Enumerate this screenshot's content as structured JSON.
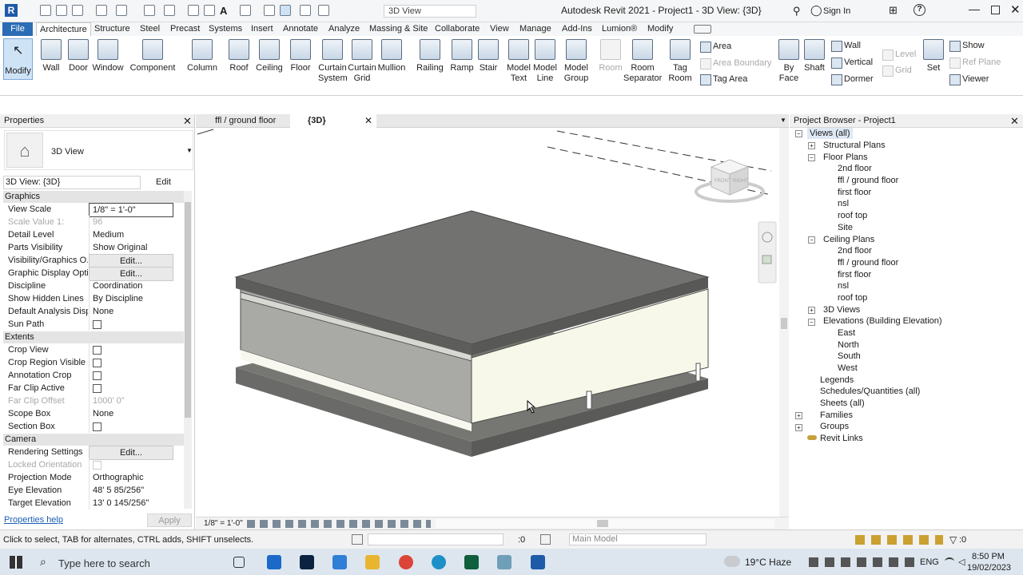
{
  "qat": {
    "view_dropdown": "3D View",
    "title": "Autodesk Revit 2021 - Project1 - 3D View: {3D}",
    "sign_in": "Sign In"
  },
  "tabs": [
    "File",
    "Architecture",
    "Structure",
    "Steel",
    "Precast",
    "Systems",
    "Insert",
    "Annotate",
    "Analyze",
    "Massing & Site",
    "Collaborate",
    "View",
    "Manage",
    "Add-Ins",
    "Lumion®",
    "Modify"
  ],
  "ribbon": {
    "modify": "Modify",
    "build": [
      [
        "Wall",
        "Door",
        "Window",
        "Component",
        "Column",
        "Roof",
        "Ceiling",
        "Floor",
        "Curtain",
        "Curtain",
        "Mullion"
      ],
      [
        "",
        "",
        "",
        "",
        "",
        "",
        "",
        "",
        "System",
        "Grid",
        ""
      ]
    ],
    "circ": [
      [
        "Railing",
        "Ramp",
        "Stair"
      ]
    ],
    "model": [
      [
        "Model",
        "Model",
        "Model"
      ],
      [
        "Text",
        "Line",
        "Group"
      ]
    ],
    "room": [
      "Room",
      "Room",
      "Tag",
      "Separator",
      "Room"
    ],
    "area": [
      "Area",
      "Area  Boundary",
      "Tag  Area"
    ],
    "opening": [
      "By",
      "Face",
      "Shaft",
      "Wall",
      "Vertical",
      "Dormer"
    ],
    "datum": [
      "Level",
      "Grid"
    ],
    "set": "Set",
    "show": [
      "Show",
      "Ref  Plane",
      "Viewer"
    ]
  },
  "props": {
    "title": "Properties",
    "type_name": "3D View",
    "selector": "3D View: {3D}",
    "edit_type": "Edit Type",
    "sections": [
      "Graphics",
      "Extents",
      "Camera"
    ],
    "graphics": [
      [
        "View Scale",
        "1/8\" = 1'-0\""
      ],
      [
        "Scale Value    1:",
        "96"
      ],
      [
        "Detail Level",
        "Medium"
      ],
      [
        "Parts Visibility",
        "Show Original"
      ],
      [
        "Visibility/Graphics O...",
        "Edit..."
      ],
      [
        "Graphic Display Opti...",
        "Edit..."
      ],
      [
        "Discipline",
        "Coordination"
      ],
      [
        "Show Hidden Lines",
        "By Discipline"
      ],
      [
        "Default Analysis Disp...",
        "None"
      ],
      [
        "Sun Path",
        ""
      ]
    ],
    "extents": [
      [
        "Crop View",
        ""
      ],
      [
        "Crop Region Visible",
        ""
      ],
      [
        "Annotation Crop",
        ""
      ],
      [
        "Far Clip Active",
        ""
      ],
      [
        "Far Clip Offset",
        "1000'  0\""
      ],
      [
        "Scope Box",
        "None"
      ],
      [
        "Section Box",
        ""
      ]
    ],
    "camera": [
      [
        "Rendering Settings",
        "Edit..."
      ],
      [
        "Locked Orientation",
        ""
      ],
      [
        "Projection Mode",
        "Orthographic"
      ],
      [
        "Eye Elevation",
        "48'  5 85/256\""
      ],
      [
        "Target Elevation",
        "13'  0 145/256\""
      ]
    ],
    "help": "Properties help",
    "apply": "Apply"
  },
  "view": {
    "tab1": "ffl / ground floor",
    "tab2": "{3D}",
    "scale": "1/8\" = 1'-0\"",
    "cube_front": "FRONT",
    "cube_right": "RIGHT"
  },
  "browser": {
    "title": "Project Browser - Project1",
    "views_all": "Views (all)",
    "structural": "Structural Plans",
    "floor_plans": "Floor Plans",
    "floor_items": [
      "2nd floor",
      "ffl / ground floor",
      "first floor",
      "nsl",
      "roof top",
      "Site"
    ],
    "ceiling_plans": "Ceiling Plans",
    "ceiling_items": [
      "2nd floor",
      "ffl / ground floor",
      "first floor",
      "nsl",
      "roof top"
    ],
    "views3d": "3D Views",
    "elevations": "Elevations (Building Elevation)",
    "elev_items": [
      "East",
      "North",
      "South",
      "West"
    ],
    "others": [
      "Legends",
      "Schedules/Quantities (all)",
      "Sheets (all)",
      "Families",
      "Groups",
      "Revit Links"
    ]
  },
  "status": {
    "message": "Click to select, TAB for alternates, CTRL adds, SHIFT unselects.",
    "count": ":0",
    "model": "Main Model",
    "filter": ":0"
  },
  "taskbar": {
    "search": "Type here to search",
    "weather": "19°C  Haze",
    "lang": "ENG",
    "time": "8:50 PM",
    "date": "19/02/2023"
  }
}
